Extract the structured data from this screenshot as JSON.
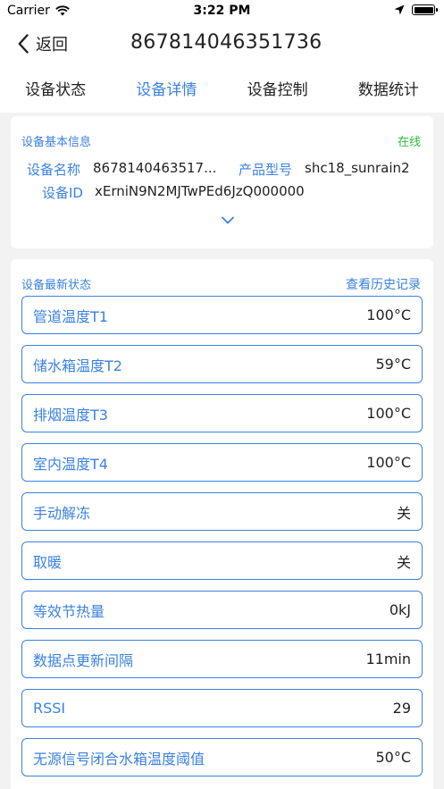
{
  "status_bar": {
    "carrier": "Carrier",
    "time": "3:22 PM"
  },
  "nav": {
    "back_label": "返回",
    "title": "867814046351736"
  },
  "tabs": [
    {
      "label": "设备状态"
    },
    {
      "label": "设备详情"
    },
    {
      "label": "设备控制"
    },
    {
      "label": "数据统计"
    }
  ],
  "active_tab": "设备详情",
  "device_info": {
    "title": "设备基本信息",
    "status": "在线",
    "name_label": "设备名称",
    "name_value": "8678140463517...",
    "model_label": "产品型号",
    "model_value": "shc18_sunrain2",
    "id_label": "设备ID",
    "id_value": "xErniN9N2MJTwPEd6JzQ000000"
  },
  "latest_status": {
    "title": "设备最新状态",
    "history_link": "查看历史记录",
    "items": [
      {
        "label": "管道温度T1",
        "value": "100°C"
      },
      {
        "label": "储水箱温度T2",
        "value": "59°C"
      },
      {
        "label": "排烟温度T3",
        "value": "100°C"
      },
      {
        "label": "室内温度T4",
        "value": "100°C"
      },
      {
        "label": "手动解冻",
        "value": "关"
      },
      {
        "label": "取暖",
        "value": "关"
      },
      {
        "label": "等效节热量",
        "value": "0kJ"
      },
      {
        "label": "数据点更新间隔",
        "value": "11min"
      },
      {
        "label": "RSSI",
        "value": "29"
      },
      {
        "label": "无源信号闭合水箱温度阈值",
        "value": "50°C"
      }
    ]
  },
  "colors": {
    "accent": "#3b82e0",
    "online": "#2bbf3c"
  }
}
